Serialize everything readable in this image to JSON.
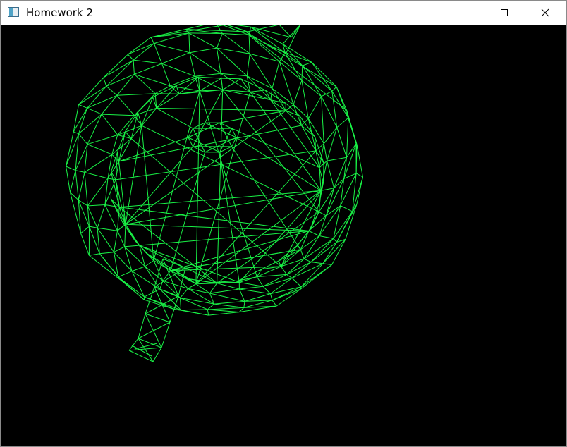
{
  "window": {
    "title": "Homework 2",
    "icon": "window-app-icon",
    "controls": {
      "minimize_icon": "minimize-icon",
      "maximize_icon": "maximize-icon",
      "close_icon": "close-icon"
    }
  },
  "viewport": {
    "background_color": "#000000",
    "wire_color": "#19f246",
    "content": "wireframe-teapot-top-view"
  }
}
